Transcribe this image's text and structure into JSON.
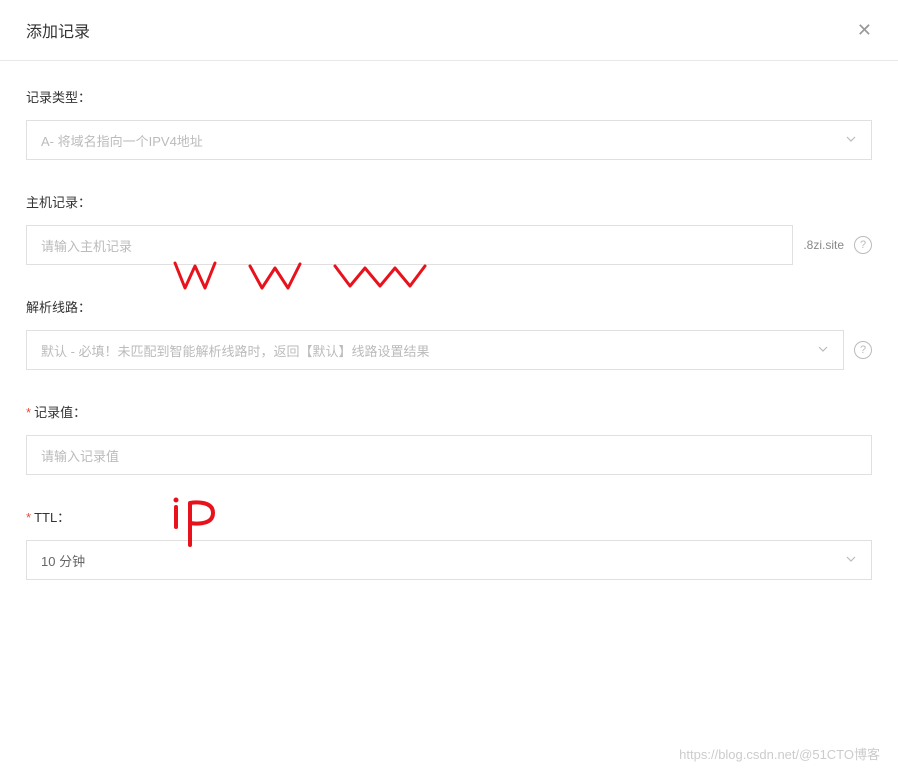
{
  "header": {
    "title": "添加记录"
  },
  "form": {
    "recordType": {
      "label": "记录类型：",
      "value": "A- 将域名指向一个IPV4地址"
    },
    "hostRecord": {
      "label": "主机记录：",
      "placeholder": "请输入主机记录",
      "suffix": ".8zi.site"
    },
    "resolveLine": {
      "label": "解析线路：",
      "value": "默认 - 必填！未匹配到智能解析线路时，返回【默认】线路设置结果"
    },
    "recordValue": {
      "label": "记录值：",
      "placeholder": "请输入记录值"
    },
    "ttl": {
      "label": "TTL：",
      "value": "10 分钟"
    }
  },
  "watermark": "https://blog.csdn.net/@51CTO博客"
}
